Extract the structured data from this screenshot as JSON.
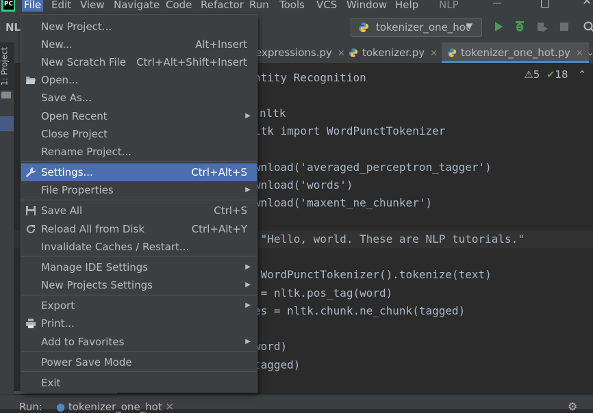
{
  "window": {
    "title": "NLP",
    "menu": [
      {
        "label": "File"
      },
      {
        "label": "Edit"
      },
      {
        "label": "View"
      },
      {
        "label": "Navigate"
      },
      {
        "label": "Code"
      },
      {
        "label": "Refactor"
      },
      {
        "label": "Run"
      },
      {
        "label": "Tools"
      },
      {
        "label": "VCS"
      },
      {
        "label": "Window"
      },
      {
        "label": "Help"
      }
    ]
  },
  "toolbar": {
    "project_name": "NL",
    "run_config": "tokenizer_one_hot"
  },
  "tool_strip": {
    "project_tab": "1: Project"
  },
  "tabs": [
    {
      "label": "expressions.py"
    },
    {
      "label": "tokenizer.py"
    },
    {
      "label": "tokenizer_one_hot.py"
    }
  ],
  "inspection": {
    "warnings": "5",
    "ok": "18"
  },
  "code_lines": [
    {
      "text": "ntity Recognition"
    },
    {
      "text": "nltk"
    },
    {
      "text": "ltk import WordPunctTokenizer"
    },
    {
      "text": "wnload('averaged_perceptron_tagger')"
    },
    {
      "text": "wnload('words')"
    },
    {
      "text": "wnload('maxent_ne_chunker')"
    },
    {
      "text": " \"Hello, world. These are NLP tutorials.\""
    },
    {
      "text": " WordPunctTokenizer().tokenize(text)"
    },
    {
      "text": " = nltk.pos_tag(word)"
    },
    {
      "text": "es = nltk.chunk.ne_chunk(tagged)"
    },
    {
      "text": "word)"
    },
    {
      "text": "tagged)"
    }
  ],
  "bottom": {
    "run_label": "Run:",
    "run_tab": "tokenizer_one_hot"
  },
  "file_menu": {
    "items": [
      {
        "label": "New Project...",
        "shortcut": "",
        "submenu": false
      },
      {
        "label": "New...",
        "shortcut": "Alt+Insert",
        "submenu": false
      },
      {
        "label": "New Scratch File",
        "shortcut": "Ctrl+Alt+Shift+Insert",
        "submenu": false
      },
      {
        "label": "Open...",
        "shortcut": "",
        "submenu": false
      },
      {
        "label": "Save As...",
        "shortcut": "",
        "submenu": false
      },
      {
        "label": "Open Recent",
        "shortcut": "",
        "submenu": true
      },
      {
        "label": "Close Project",
        "shortcut": "",
        "submenu": false
      },
      {
        "label": "Rename Project...",
        "shortcut": "",
        "submenu": false
      },
      {
        "label": "Settings...",
        "shortcut": "Ctrl+Alt+S",
        "submenu": false
      },
      {
        "label": "File Properties",
        "shortcut": "",
        "submenu": true
      },
      {
        "label": "Save All",
        "shortcut": "Ctrl+S",
        "submenu": false
      },
      {
        "label": "Reload All from Disk",
        "shortcut": "Ctrl+Alt+Y",
        "submenu": false
      },
      {
        "label": "Invalidate Caches / Restart...",
        "shortcut": "",
        "submenu": false
      },
      {
        "label": "Manage IDE Settings",
        "shortcut": "",
        "submenu": true
      },
      {
        "label": "New Projects Settings",
        "shortcut": "",
        "submenu": true
      },
      {
        "label": "Export",
        "shortcut": "",
        "submenu": true
      },
      {
        "label": "Print...",
        "shortcut": "",
        "submenu": false
      },
      {
        "label": "Add to Favorites",
        "shortcut": "",
        "submenu": true
      },
      {
        "label": "Power Save Mode",
        "shortcut": "",
        "submenu": false
      },
      {
        "label": "Exit",
        "shortcut": "",
        "submenu": false
      }
    ]
  }
}
